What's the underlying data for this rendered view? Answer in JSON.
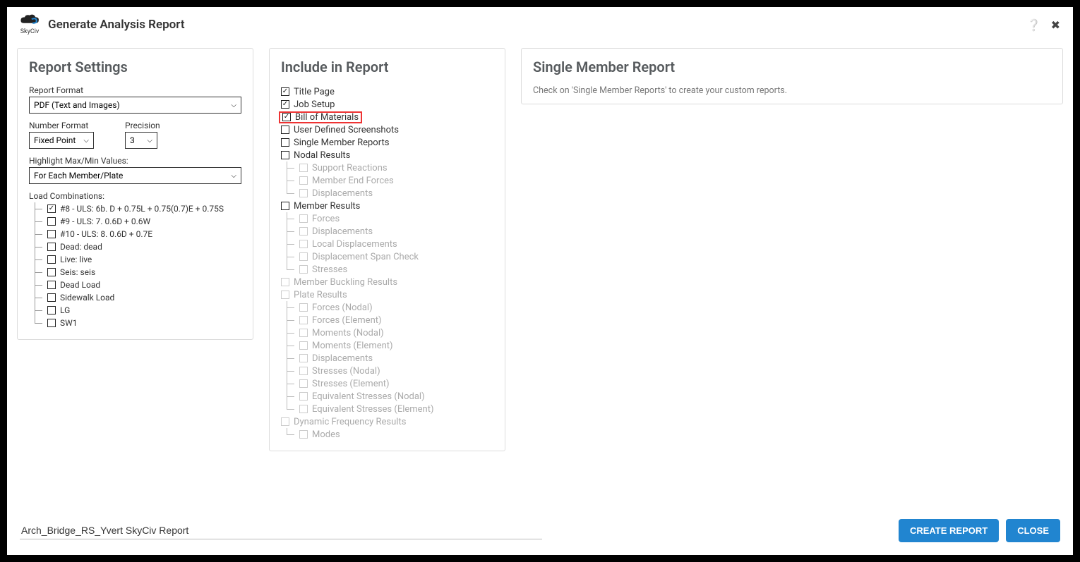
{
  "header": {
    "logo_text": "SkyCiv",
    "title": "Generate Analysis Report"
  },
  "settings": {
    "title": "Report Settings",
    "report_format_label": "Report Format",
    "report_format_value": "PDF (Text and Images)",
    "number_format_label": "Number Format",
    "number_format_value": "Fixed Point",
    "precision_label": "Precision",
    "precision_value": "3",
    "highlight_label": "Highlight Max/Min Values:",
    "highlight_value": "For Each Member/Plate",
    "load_comb_label": "Load Combinations:",
    "load_combinations": [
      {
        "label": "#8 - ULS: 6b. D + 0.75L + 0.75(0.7)E + 0.75S",
        "checked": true
      },
      {
        "label": "#9 - ULS: 7. 0.6D + 0.6W",
        "checked": false
      },
      {
        "label": "#10 - ULS: 8. 0.6D + 0.7E",
        "checked": false
      },
      {
        "label": "Dead: dead",
        "checked": false
      },
      {
        "label": "Live: live",
        "checked": false
      },
      {
        "label": "Seis: seis",
        "checked": false
      },
      {
        "label": "Dead Load",
        "checked": false
      },
      {
        "label": "Sidewalk Load",
        "checked": false
      },
      {
        "label": "LG",
        "checked": false
      },
      {
        "label": "SW1",
        "checked": false
      }
    ]
  },
  "include": {
    "title": "Include in Report",
    "items": {
      "title_page": "Title Page",
      "job_setup": "Job Setup",
      "bom": "Bill of Materials",
      "uds": "User Defined Screenshots",
      "smr": "Single Member Reports",
      "nodal": "Nodal Results",
      "nodal_sub": [
        "Support Reactions",
        "Member End Forces",
        "Displacements"
      ],
      "member": "Member Results",
      "member_sub": [
        "Forces",
        "Displacements",
        "Local Displacements",
        "Displacement Span Check",
        "Stresses"
      ],
      "buckling": "Member Buckling Results",
      "plate": "Plate Results",
      "plate_sub": [
        "Forces (Nodal)",
        "Forces (Element)",
        "Moments (Nodal)",
        "Moments (Element)",
        "Displacements",
        "Stresses (Nodal)",
        "Stresses (Element)",
        "Equivalent Stresses (Nodal)",
        "Equivalent Stresses (Element)"
      ],
      "dynamic": "Dynamic Frequency Results",
      "dynamic_sub": [
        "Modes"
      ]
    }
  },
  "rightpanel": {
    "title": "Single Member Report",
    "hint": "Check on 'Single Member Reports' to create your custom reports."
  },
  "footer": {
    "report_name": "Arch_Bridge_RS_Yvert SkyCiv Report",
    "create": "CREATE REPORT",
    "close": "CLOSE"
  }
}
